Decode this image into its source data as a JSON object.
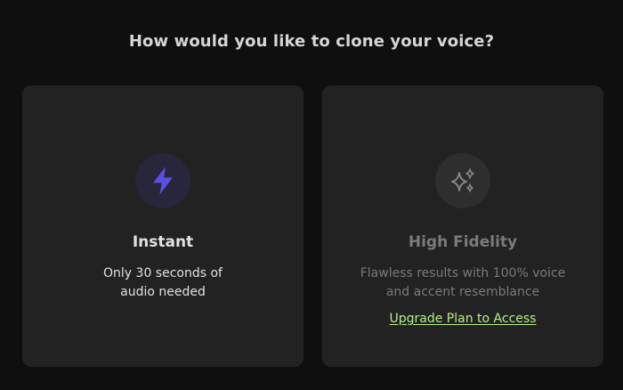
{
  "heading": "How would you like to clone your voice?",
  "options": [
    {
      "title": "Instant",
      "description_lines": [
        "Only 30 seconds of",
        "audio needed"
      ],
      "icon": "lightning-bolt-icon"
    },
    {
      "title": "High Fidelity",
      "description_lines": [
        "Flawless results with 100% voice",
        "and accent resemblance"
      ],
      "icon": "sparkles-icon",
      "upgrade_link": "Upgrade Plan to Access"
    }
  ],
  "colors": {
    "background": "#0f0f0f",
    "card": "#222222",
    "accent_bolt": "#5b50e6",
    "upgrade_link": "#b6ef8b",
    "disabled_text": "#7a7a7a"
  }
}
